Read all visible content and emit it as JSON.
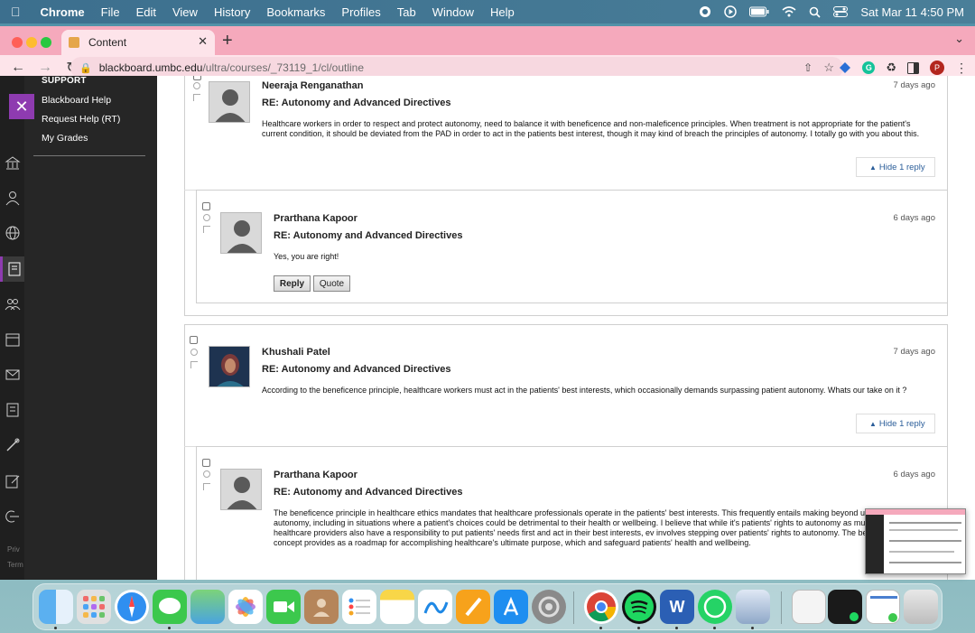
{
  "menubar": {
    "app": "Chrome",
    "items": [
      "File",
      "Edit",
      "View",
      "History",
      "Bookmarks",
      "Profiles",
      "Tab",
      "Window",
      "Help"
    ],
    "clock": "Sat Mar 11  4:50 PM"
  },
  "browser": {
    "tab_title": "Content",
    "url_host": "blackboard.umbc.edu",
    "url_path": "/ultra/courses/_73119_1/cl/outline",
    "profile_initial": "P",
    "extension_letter": "G"
  },
  "sidebar": {
    "heading": "SUPPORT",
    "links": [
      "Blackboard Help",
      "Request Help (RT)",
      "My Grades"
    ],
    "footer": [
      "Priv",
      "Term"
    ]
  },
  "posts": [
    {
      "author": "Neeraja Renganathan",
      "title": "RE: Autonomy and Advanced Directives",
      "date": "7 days ago",
      "body": "Healthcare workers in order to respect and protect autonomy, need to balance it with beneficence and non-maleficence principles. When treatment is not appropriate for the patient's current condition, it should be deviated from the PAD in order to act in the patients best interest, though it may kind of breach the principles of autonomy. I totally go with you about this.",
      "hide_label": "Hide 1 reply"
    },
    {
      "author": "Prarthana Kapoor",
      "title": "RE: Autonomy and Advanced Directives",
      "date": "6 days ago",
      "body": "Yes, you are right!",
      "reply_label": "Reply",
      "quote_label": "Quote"
    },
    {
      "author": "Khushali Patel",
      "title": "RE: Autonomy and Advanced Directives",
      "date": "7 days ago",
      "body": "According to the beneficence principle, healthcare workers must act in the patients' best interests, which occasionally demands surpassing patient autonomy. Whats our take on it ?",
      "hide_label": "Hide 1 reply"
    },
    {
      "author": "Prarthana Kapoor",
      "title": "RE: Autonomy and Advanced Directives",
      "date": "6 days ago",
      "body": "The beneficence principle in healthcare ethics mandates that healthcare professionals operate in the patients' best interests. This frequently entails making beyond upholding patient autonomy, including in situations where a patient's choices could be detrimental to their health or wellbeing. I believe that while it's patients' rights to autonomy as much as possible, healthcare providers also have a responsibility to put patients' needs first and act in their best interests, ev involves stepping over patients' rights to autonomy. The beneficence concept provides as a roadmap for accomplishing healthcare's ultimate purpose, which and safeguard patients' health and wellbeing."
    }
  ],
  "dock": {
    "word_letter": "W"
  },
  "colors": {
    "accent": "#8e3bb0",
    "tabbar": "#f5a9bc",
    "link": "#2a5d99"
  }
}
